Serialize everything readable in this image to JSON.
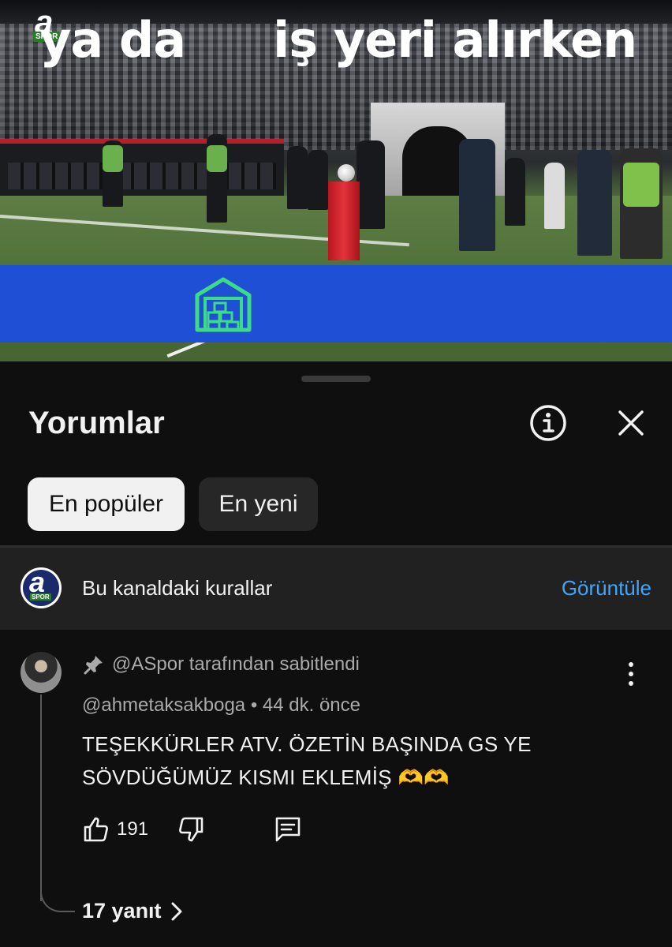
{
  "video": {
    "channel_logo_letter": "a",
    "channel_logo_sub": "SPOR",
    "banner_part1": "ya da",
    "banner_part2": "iş yeri alırken",
    "banner_icon": "warehouse-icon"
  },
  "sheet": {
    "title": "Yorumlar",
    "info_icon": "info-icon",
    "close_icon": "close-icon"
  },
  "sort": {
    "top_label": "En popüler",
    "newest_label": "En yeni",
    "selected": "En popüler"
  },
  "rules": {
    "avatar_letter": "a",
    "avatar_sub": "SPOR",
    "text": "Bu kanaldaki kurallar",
    "link": "Görüntüle"
  },
  "comment": {
    "pinned_text": "@ASpor tarafından sabitlendi",
    "author": "@ahmetaksakboga",
    "time": "44 dk. önce",
    "meta": "@ahmetaksakboga • 44 dk. önce",
    "body_line1": "TEŞEKKÜRLER ATV. ÖZETİN BAŞINDA GS YE",
    "body_line2": "SÖVDÜĞÜMÜZ KISMI EKLEMİŞ 🫶🫶",
    "likes": "191",
    "replies_label": "17 yanıt"
  },
  "colors": {
    "background": "#0f0f0f",
    "banner": "#1e4fd4",
    "link": "#3ea6ff",
    "chip_active": "#f1f1f1",
    "chip_inactive": "#272727"
  }
}
